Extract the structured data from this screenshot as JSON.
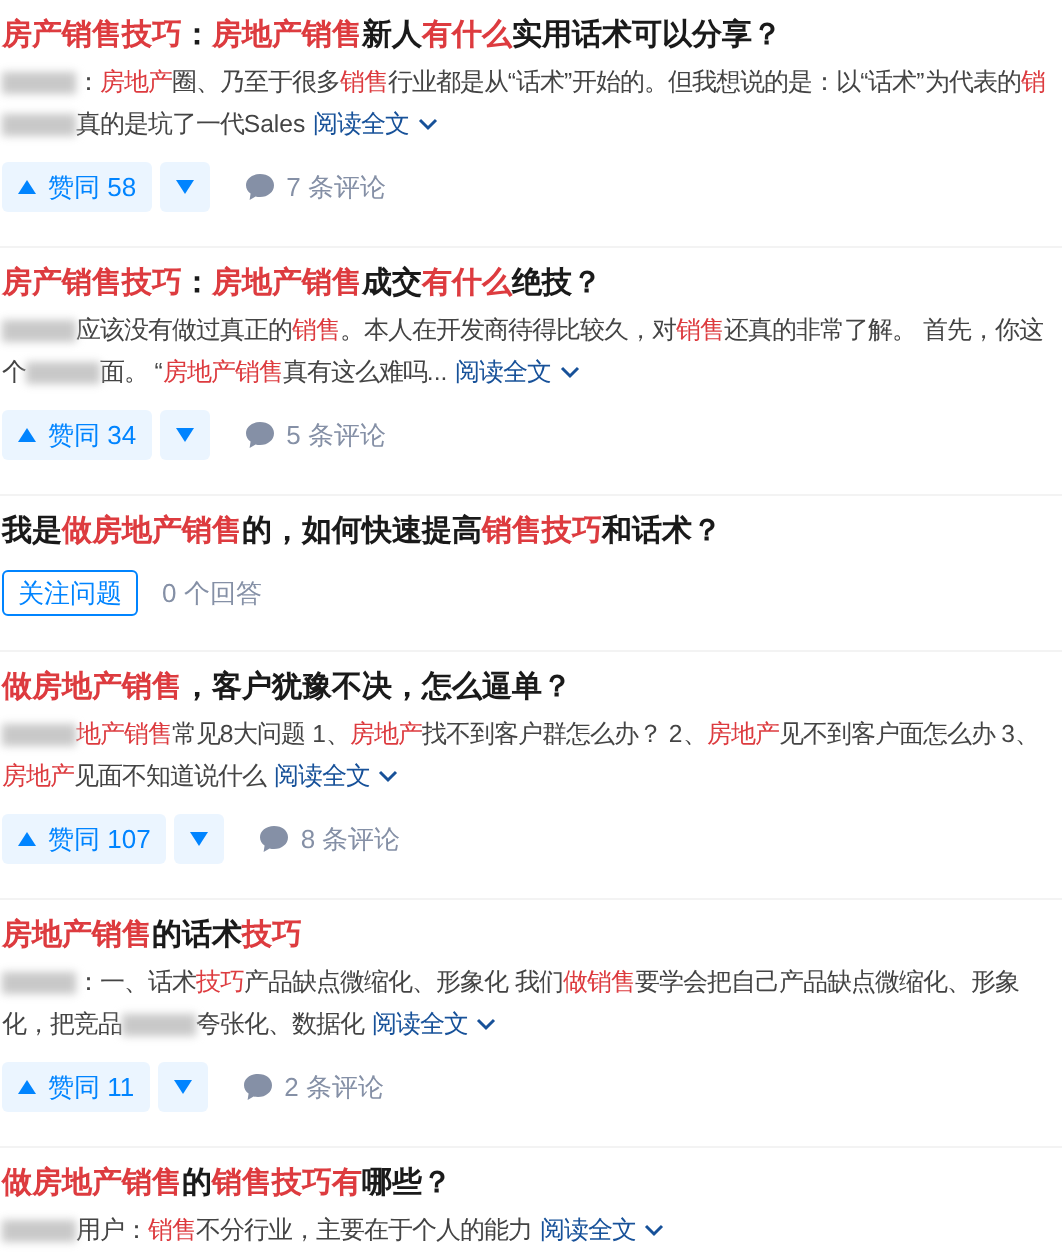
{
  "results": [
    {
      "kind": "answer",
      "title": [
        {
          "kind": "highlight",
          "text": "房产销售技巧"
        },
        {
          "kind": "plain",
          "text": "："
        },
        {
          "kind": "highlight",
          "text": "房地产销售"
        },
        {
          "kind": "plain",
          "text": "新人"
        },
        {
          "kind": "highlight",
          "text": "有什么"
        },
        {
          "kind": "plain",
          "text": "实用话术可以分享？"
        }
      ],
      "excerpt": [
        {
          "kind": "blur"
        },
        {
          "kind": "plain",
          "text": "："
        },
        {
          "kind": "highlight",
          "text": "房地产"
        },
        {
          "kind": "plain",
          "text": "圈、乃至于很多"
        },
        {
          "kind": "highlight",
          "text": "销售"
        },
        {
          "kind": "plain",
          "text": "行业都是从“话术”开始的。但我想说的是：以“话术”为代表的"
        },
        {
          "kind": "highlight",
          "text": "销"
        },
        {
          "kind": "blur"
        },
        {
          "kind": "plain",
          "text": "真的是坑了一代Sales"
        }
      ],
      "read_more": "阅读全文",
      "upvote": "赞同 58",
      "comments": "7 条评论"
    },
    {
      "kind": "answer",
      "title": [
        {
          "kind": "highlight",
          "text": "房产销售技巧"
        },
        {
          "kind": "plain",
          "text": "："
        },
        {
          "kind": "highlight",
          "text": "房地产销售"
        },
        {
          "kind": "plain",
          "text": "成交"
        },
        {
          "kind": "highlight",
          "text": "有什么"
        },
        {
          "kind": "plain",
          "text": "绝技？"
        }
      ],
      "excerpt": [
        {
          "kind": "blur"
        },
        {
          "kind": "plain",
          "text": "应该没有做过真正的"
        },
        {
          "kind": "highlight",
          "text": "销售"
        },
        {
          "kind": "plain",
          "text": "。本人在开发商待得比较久，对"
        },
        {
          "kind": "highlight",
          "text": "销售"
        },
        {
          "kind": "plain",
          "text": "还真的非常了解。 首先，你这个"
        },
        {
          "kind": "blur"
        },
        {
          "kind": "plain",
          "text": "面。 “"
        },
        {
          "kind": "highlight",
          "text": "房地产销售"
        },
        {
          "kind": "plain",
          "text": "真有这么难吗..."
        }
      ],
      "read_more": "阅读全文",
      "upvote": "赞同 34",
      "comments": "5 条评论"
    },
    {
      "kind": "question",
      "title": [
        {
          "kind": "plain",
          "text": "我是"
        },
        {
          "kind": "highlight",
          "text": "做房地产销售"
        },
        {
          "kind": "plain",
          "text": "的，如何快速提高"
        },
        {
          "kind": "highlight",
          "text": "销售技巧"
        },
        {
          "kind": "plain",
          "text": "和话术？"
        }
      ],
      "follow": "关注问题",
      "answers": "0 个回答"
    },
    {
      "kind": "answer",
      "title": [
        {
          "kind": "highlight",
          "text": "做房地产销售"
        },
        {
          "kind": "plain",
          "text": "，客户犹豫不决，怎么逼单？"
        }
      ],
      "excerpt": [
        {
          "kind": "blur"
        },
        {
          "kind": "highlight",
          "text": "地产销售"
        },
        {
          "kind": "plain",
          "text": "常见8大问题 1、"
        },
        {
          "kind": "highlight",
          "text": "房地产"
        },
        {
          "kind": "plain",
          "text": "找不到客户群怎么办？ 2、"
        },
        {
          "kind": "highlight",
          "text": "房地产"
        },
        {
          "kind": "plain",
          "text": "见不到客户面怎么办 3、"
        },
        {
          "kind": "highlight",
          "text": "房地产"
        },
        {
          "kind": "plain",
          "text": "见面不知道说什么"
        }
      ],
      "read_more": "阅读全文",
      "upvote": "赞同 107",
      "comments": "8 条评论"
    },
    {
      "kind": "answer",
      "title": [
        {
          "kind": "highlight",
          "text": "房地产销售"
        },
        {
          "kind": "plain",
          "text": "的话术"
        },
        {
          "kind": "highlight",
          "text": "技巧"
        }
      ],
      "excerpt": [
        {
          "kind": "blur"
        },
        {
          "kind": "plain",
          "text": "：一、话术"
        },
        {
          "kind": "highlight",
          "text": "技巧"
        },
        {
          "kind": "plain",
          "text": "产品缺点微缩化、形象化 我们"
        },
        {
          "kind": "highlight",
          "text": "做销售"
        },
        {
          "kind": "plain",
          "text": "要学会把自己产品缺点微缩化、形象化，把竞品"
        },
        {
          "kind": "blur"
        },
        {
          "kind": "plain",
          "text": "夸张化、数据化"
        }
      ],
      "read_more": "阅读全文",
      "upvote": "赞同 11",
      "comments": "2 条评论"
    },
    {
      "kind": "answer",
      "title": [
        {
          "kind": "highlight",
          "text": "做房地产销售"
        },
        {
          "kind": "plain",
          "text": "的"
        },
        {
          "kind": "highlight",
          "text": "销售技巧有"
        },
        {
          "kind": "plain",
          "text": "哪些？"
        }
      ],
      "excerpt": [
        {
          "kind": "blur"
        },
        {
          "kind": "plain",
          "text": "用户："
        },
        {
          "kind": "highlight",
          "text": "销售"
        },
        {
          "kind": "plain",
          "text": "不分行业，主要在于个人的能力"
        }
      ],
      "read_more": "阅读全文"
    }
  ]
}
